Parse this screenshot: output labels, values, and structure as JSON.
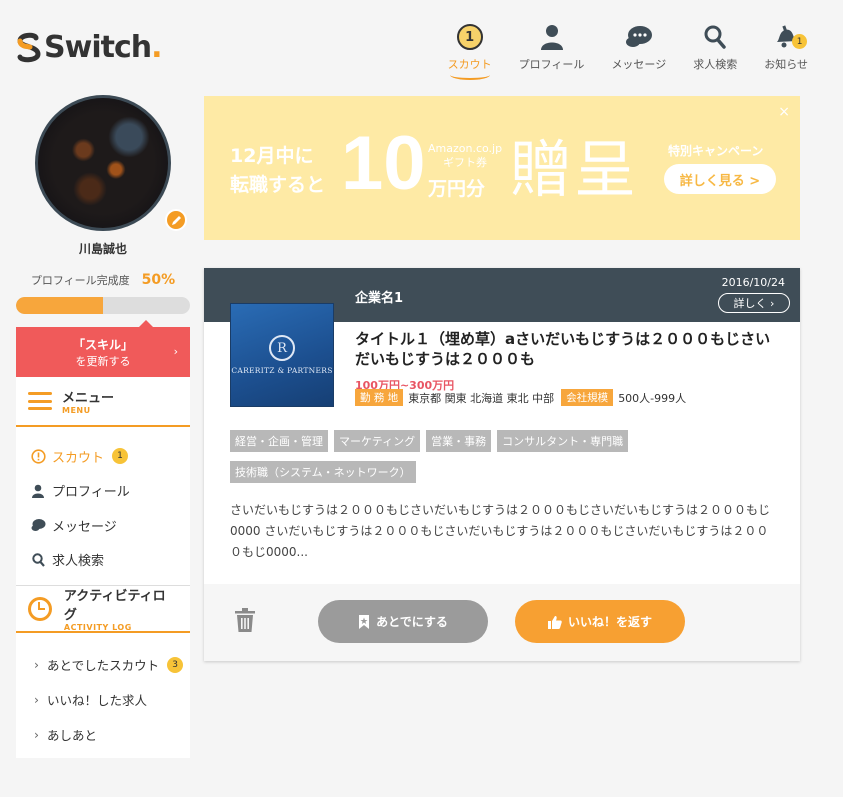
{
  "app": {
    "logo_text": "Switch",
    "logo_dot": "."
  },
  "topnav": [
    {
      "label": "スカウト",
      "icon": "scout-icon",
      "badge": "1"
    },
    {
      "label": "プロフィール",
      "icon": "user-icon"
    },
    {
      "label": "メッセージ",
      "icon": "chat-icon"
    },
    {
      "label": "求人検索",
      "icon": "search-icon"
    },
    {
      "label": "お知らせ",
      "icon": "bell-icon",
      "badge": "1"
    }
  ],
  "sidebar": {
    "user_name": "川島誠也",
    "profile_rate_label": "プロフィール完成度",
    "profile_rate_value": "50%",
    "profile_rate_fraction": 0.5,
    "skill_btn_line1": "「スキル」",
    "skill_btn_line2": "を更新する",
    "menu_title": "メニュー",
    "menu_sub": "MENU",
    "menu_items": [
      {
        "label": "スカウト",
        "icon": "alert-circle-icon",
        "badge": "1"
      },
      {
        "label": "プロフィール",
        "icon": "user-icon"
      },
      {
        "label": "メッセージ",
        "icon": "chat-icon"
      },
      {
        "label": "求人検索",
        "icon": "search-icon"
      }
    ],
    "activity_title": "アクティビティログ",
    "activity_sub": "ACTIVITY LOG",
    "activity_items": [
      {
        "label": "あとでしたスカウト",
        "badge": "3"
      },
      {
        "label": "いいね！した求人"
      },
      {
        "label": "あしあと"
      }
    ]
  },
  "banner": {
    "left_line1": "12月中に",
    "left_line2": "転職すると",
    "big_number": "10",
    "amazon_line1": "Amazon.co.jp",
    "amazon_line2": "ギフト券",
    "unit": "万円分",
    "big_text": "贈呈",
    "campaign": "特別キャンペーン",
    "button": "詳しく見る >",
    "close": "×"
  },
  "job": {
    "company": "企業名1",
    "date": "2016/10/24",
    "detail_btn": "詳しく",
    "logo_monogram": "R",
    "logo_name": "CARERITZ & PARTNERS",
    "title": "タイトル１（埋め草）aさいだいもじすうは２０００もじさいだいもじすうは２０００も",
    "salary": "100万円~300万円",
    "location_tag": "勤 務 地",
    "location": "東京都 関東 北海道 東北 中部",
    "scale_tag": "会社規模",
    "scale": "500人-999人",
    "tags": [
      "経営・企画・管理",
      "マーケティング",
      "営業・事務",
      "コンサルタント・専門職",
      "技術職（システム・ネットワーク）"
    ],
    "description": "さいだいもじすうは２０００もじさいだいもじすうは２０００もじさいだいもじすうは２０００もじ0000 さいだいもじすうは２０００もじさいだいもじすうは２０００もじさいだいもじすうは２０００もじ0000...",
    "later_btn": "あとでにする",
    "like_btn": "いいね！を返す"
  },
  "colors": {
    "accent": "#f49c24",
    "skill_red": "#f05a5a",
    "header_dark": "#3f4d57",
    "banner_bg": "#feeaa5"
  }
}
